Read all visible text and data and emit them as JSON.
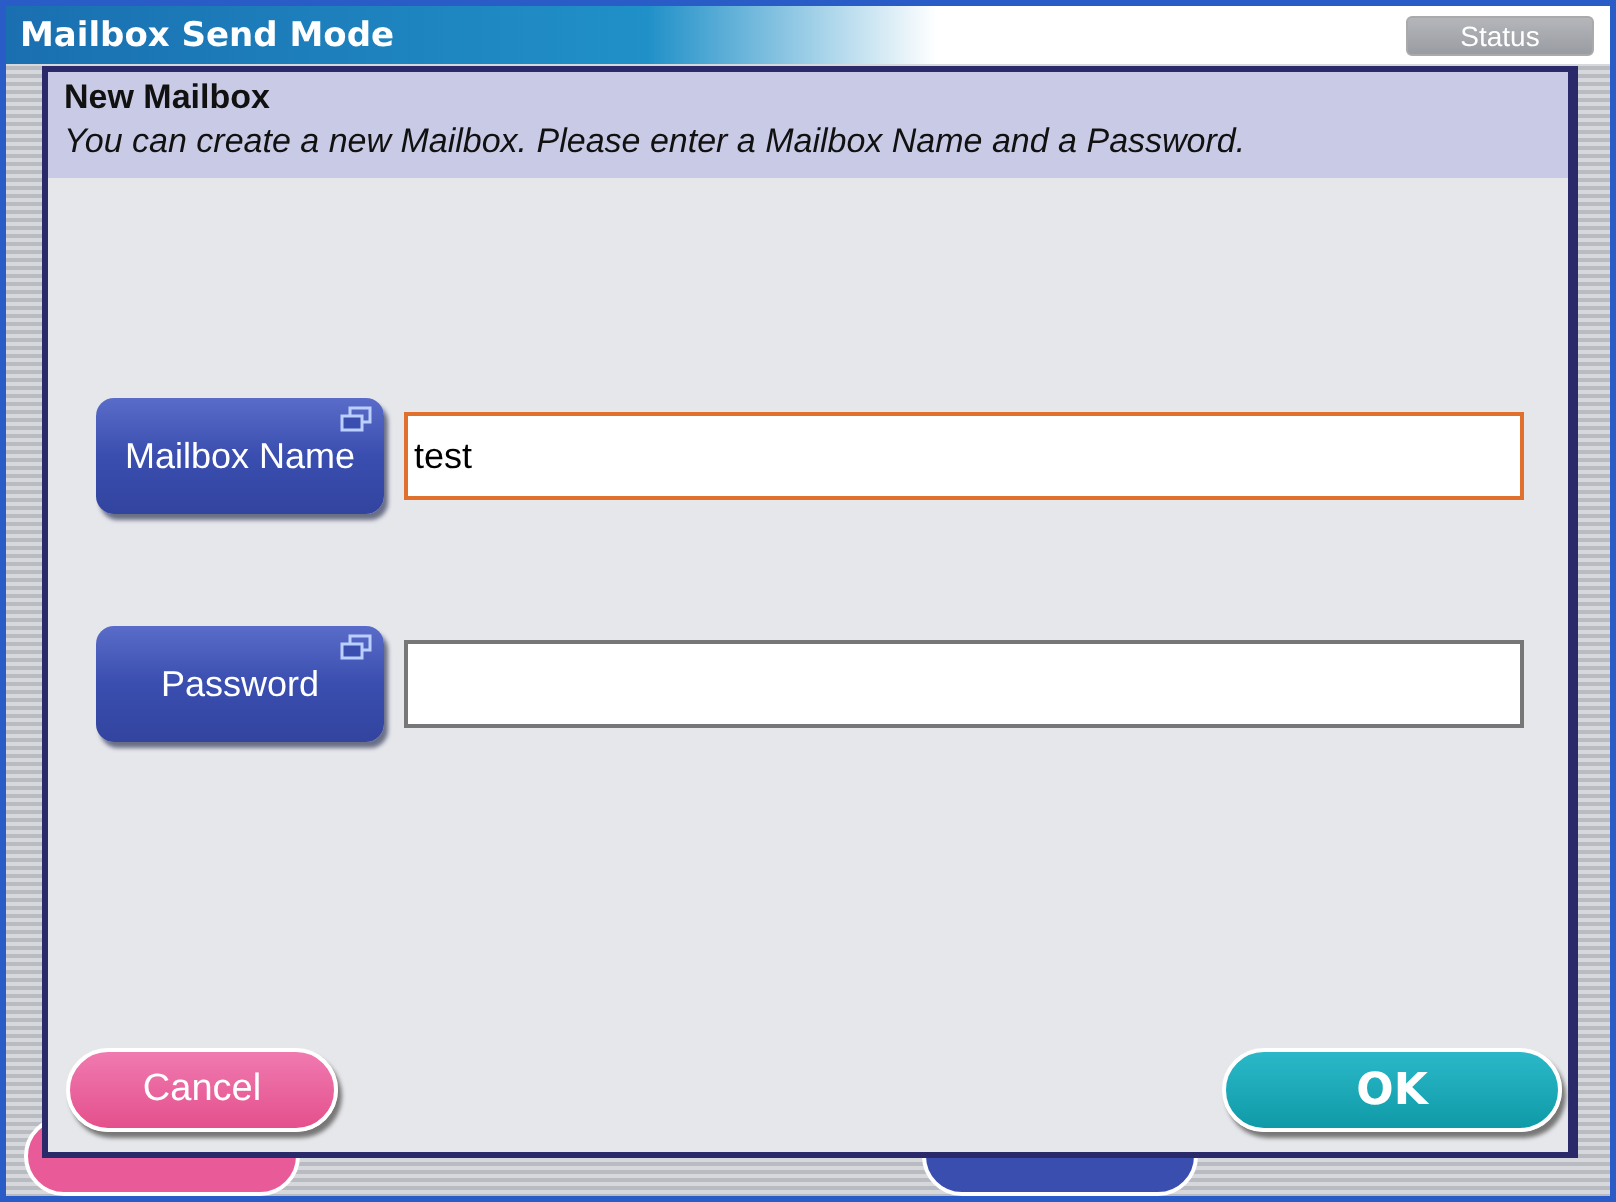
{
  "window": {
    "title": "Mailbox Send Mode",
    "status_button": {
      "label": "Status",
      "disabled": true
    }
  },
  "background_buttons": [
    {
      "kind": "pink"
    },
    {
      "kind": "blue"
    }
  ],
  "dialog": {
    "title": "New Mailbox",
    "message": "You can create a new Mailbox. Please enter a Mailbox Name and a Password.",
    "fields": [
      {
        "label": "Mailbox Name",
        "value": "test",
        "focused": true
      },
      {
        "label": "Password",
        "focused": false
      }
    ],
    "buttons": [
      {
        "label": "Cancel",
        "kind": "cancel"
      },
      {
        "label": "OK",
        "kind": "ok"
      }
    ]
  }
}
